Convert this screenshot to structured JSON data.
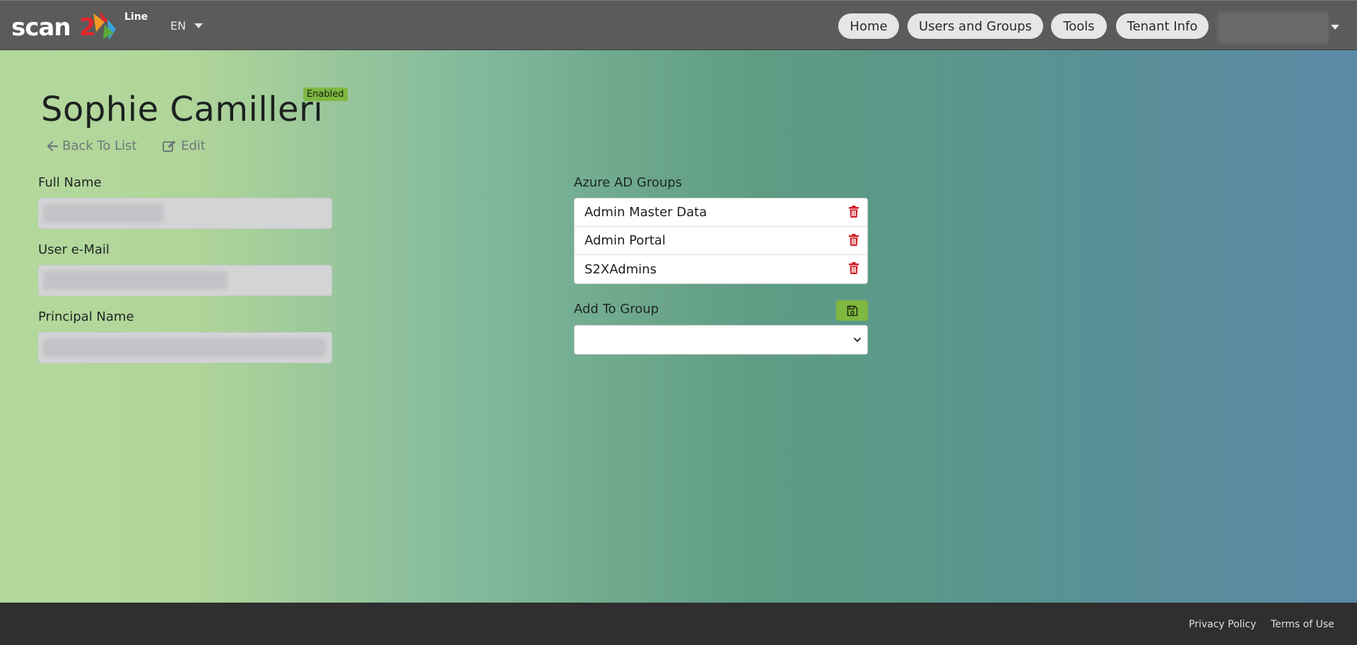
{
  "brand": {
    "logo_main": "scan",
    "logo_two": "2",
    "logo_suffix": "Line",
    "accent_red": "#e3262b",
    "accent_green": "#7fb840"
  },
  "header": {
    "language": "EN",
    "nav": {
      "home": "Home",
      "users_groups": "Users and Groups",
      "tools": "Tools",
      "tenant_info": "Tenant Info"
    },
    "user_menu_icon": "chevron-down-icon"
  },
  "user": {
    "name": "Sophie Camilleri",
    "status": "Enabled",
    "back_label": "Back To List",
    "edit_label": "Edit",
    "fields": {
      "full_name_label": "Full Name",
      "email_label": "User e-Mail",
      "principal_label": "Principal Name"
    }
  },
  "groups": {
    "label": "Azure AD Groups",
    "items": [
      {
        "name": "Admin Master Data"
      },
      {
        "name": "Admin Portal"
      },
      {
        "name": "S2XAdmins"
      }
    ],
    "add_label": "Add To Group",
    "select_value": ""
  },
  "footer": {
    "privacy": "Privacy Policy",
    "terms": "Terms of Use"
  }
}
